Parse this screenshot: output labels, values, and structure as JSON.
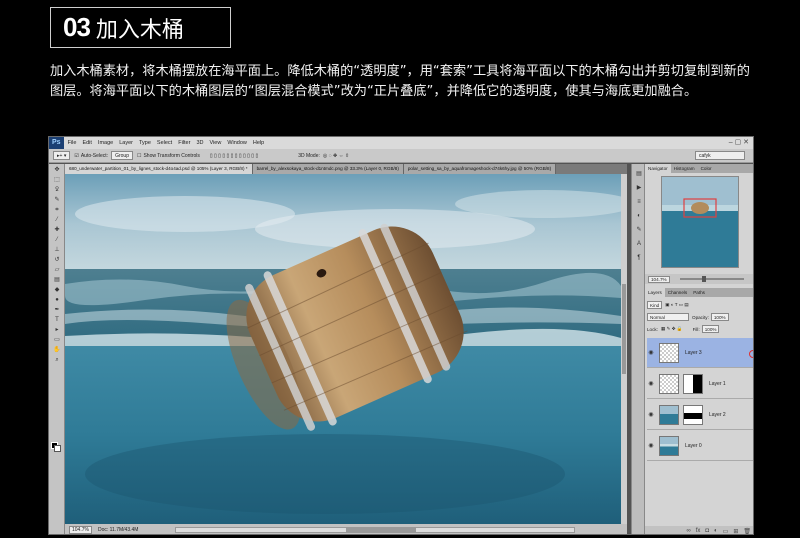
{
  "header": {
    "step_number": "03",
    "step_title": "加入木桶"
  },
  "description": "加入木桶素材，将木桶摆放在海平面上。降低木桶的“透明度”，用“套索”工具将海平面以下的木桶勾出并剪切复制到新的图层。将海平面以下的木桶图层的“图层混合模式”改为“正片叠底”，并降低它的透明度，使其与海底更加融合。",
  "photoshop": {
    "logo": "Ps",
    "menu": [
      "File",
      "Edit",
      "Image",
      "Layer",
      "Type",
      "Select",
      "Filter",
      "3D",
      "View",
      "Window",
      "Help"
    ],
    "options": {
      "auto_select": "Auto-Select:",
      "auto_select_value": "Group",
      "show_transform": "Show Transform Controls",
      "mode_3d": "3D Mode:",
      "workspace": "cafyk"
    },
    "tabs": [
      "680_underwater_partition_01_by_lignes_stock-d4o4ad.psd @ 105% (Layer 3, RGB/8) *",
      "barrel_by_alexsokaya_stock-d1ntmdc.png @ 33.3% (Layer 0, RGB/8)",
      "polar_setting_sa_by_aquafromageshock-d74k6hy.jpg @ 50% (RGB/8)"
    ],
    "status": {
      "zoom": "104.7%",
      "doc": "Doc: 11.7M/43.4M"
    },
    "panel_tabs_top": [
      "Navigator",
      "Histogram",
      "Color"
    ],
    "navigator_zoom": "104.7%",
    "panel_tabs_layers": [
      "Layers",
      "Channels",
      "Paths"
    ],
    "kind_label": "Kind",
    "blend_mode": "Normal",
    "opacity_label": "Opacity:",
    "opacity_value": "100%",
    "lock_label": "Lock:",
    "fill_label": "Fill:",
    "fill_value": "100%",
    "layers": [
      {
        "name": "Layer 3",
        "selected": true
      },
      {
        "name": "Layer 1",
        "selected": false
      },
      {
        "name": "Layer 2",
        "selected": false
      },
      {
        "name": "Layer 0",
        "selected": false
      }
    ],
    "tool_icons": [
      "move-icon",
      "marquee-icon",
      "lasso-icon",
      "quick-select-icon",
      "crop-icon",
      "eyedropper-icon",
      "healing-icon",
      "brush-icon",
      "stamp-icon",
      "history-brush-icon",
      "eraser-icon",
      "gradient-icon",
      "blur-icon",
      "dodge-icon",
      "pen-icon",
      "type-icon",
      "path-select-icon",
      "shape-icon",
      "hand-icon",
      "zoom-icon"
    ],
    "colors": {
      "selected_layer": "#9bb3e3",
      "ui_dark": "#535353",
      "sea": "#2f7b97"
    }
  }
}
